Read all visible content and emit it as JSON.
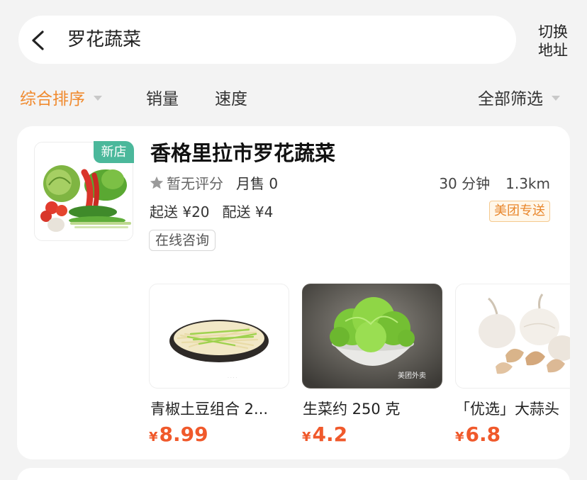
{
  "search": {
    "query": "罗花蔬菜",
    "switch_address_line1": "切换",
    "switch_address_line2": "地址"
  },
  "sort_bar": {
    "items": [
      {
        "label": "综合排序",
        "active": true
      },
      {
        "label": "销量",
        "active": false
      },
      {
        "label": "速度",
        "active": false
      }
    ],
    "filter_label": "全部筛选"
  },
  "store": {
    "badge": "新店",
    "name": "香格里拉市罗花蔬菜",
    "rating": "暂无评分",
    "monthly_sales": "月售 0",
    "delivery_time": "30 分钟",
    "distance": "1.3km",
    "min_order": "起送 ¥20",
    "delivery_fee": "配送 ¥4",
    "delivery_badge": "美团专送",
    "consult_tag": "在线咨询",
    "products": [
      {
        "name": "青椒土豆组合 2...",
        "currency": "¥",
        "price": "8.99",
        "image": "shredded-potato-image"
      },
      {
        "name": "生菜约 250 克",
        "currency": "¥",
        "price": "4.2",
        "image": "lettuce-bowl-image",
        "watermark": "美团外卖"
      },
      {
        "name": "「优选」大蒜头",
        "currency": "¥",
        "price": "6.8",
        "image": "garlic-image"
      }
    ]
  },
  "colors": {
    "accent": "#f08a2e",
    "price": "#f0592b",
    "new_badge": "#4bb89b",
    "background": "#f3f3f3"
  }
}
